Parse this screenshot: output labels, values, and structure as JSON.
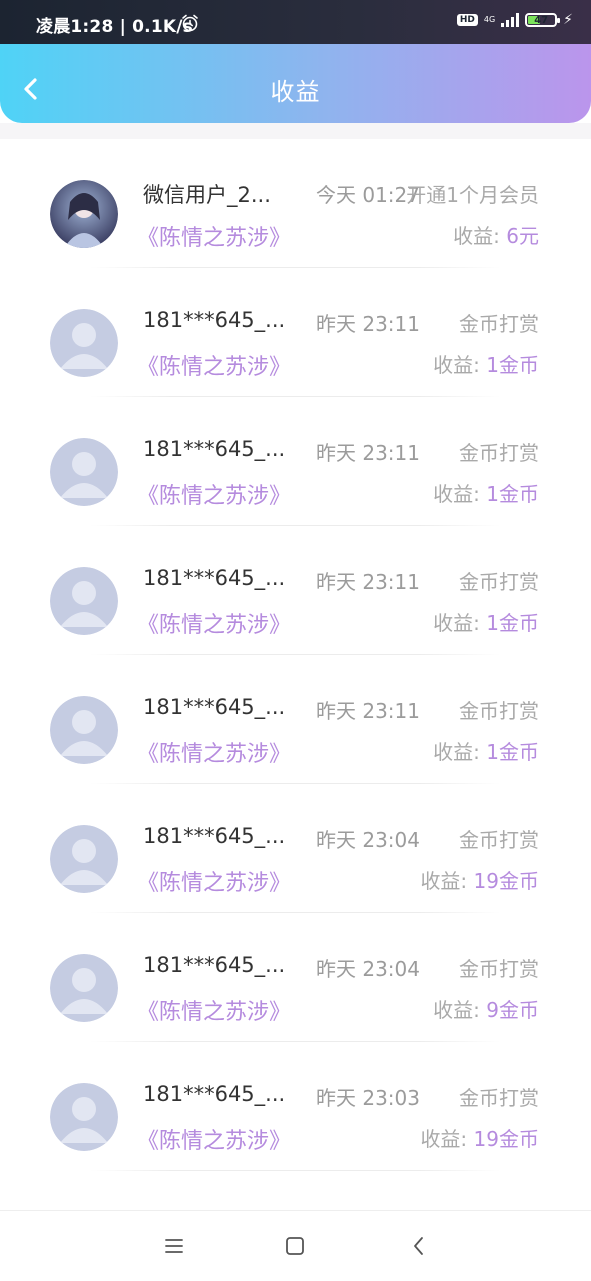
{
  "status_bar": {
    "time_speed": "凌晨1:28 | 0.1K/s",
    "hd": "HD",
    "network": "4G",
    "battery": "47",
    "battery_level": 0.47,
    "alarm_icon": "alarm-clock-icon",
    "signal_icon": "signal-bars-icon",
    "charging_icon": "lightning-bolt-icon"
  },
  "header": {
    "title": "收益",
    "back_icon": "chevron-left-icon"
  },
  "colors": {
    "header_gradient_start": "#4fd3f6",
    "header_gradient_end": "#bb95ec",
    "accent_purple": "#b58bde",
    "text_gray": "#a9a9a9"
  },
  "earnings": [
    {
      "name": "微信用户_2...",
      "time": "今天 01:27",
      "type": "开通1个月会员",
      "book": "《陈情之苏涉》",
      "earn_label": "收益: ",
      "earn_amount": "6元",
      "avatar": "custom"
    },
    {
      "name": "181***645_...",
      "time": "昨天 23:11",
      "type": "金币打赏",
      "book": "《陈情之苏涉》",
      "earn_label": "收益: ",
      "earn_amount": "1金币",
      "avatar": "default"
    },
    {
      "name": "181***645_...",
      "time": "昨天 23:11",
      "type": "金币打赏",
      "book": "《陈情之苏涉》",
      "earn_label": "收益: ",
      "earn_amount": "1金币",
      "avatar": "default"
    },
    {
      "name": "181***645_...",
      "time": "昨天 23:11",
      "type": "金币打赏",
      "book": "《陈情之苏涉》",
      "earn_label": "收益: ",
      "earn_amount": "1金币",
      "avatar": "default"
    },
    {
      "name": "181***645_...",
      "time": "昨天 23:11",
      "type": "金币打赏",
      "book": "《陈情之苏涉》",
      "earn_label": "收益: ",
      "earn_amount": "1金币",
      "avatar": "default"
    },
    {
      "name": "181***645_...",
      "time": "昨天 23:04",
      "type": "金币打赏",
      "book": "《陈情之苏涉》",
      "earn_label": "收益: ",
      "earn_amount": "19金币",
      "avatar": "default"
    },
    {
      "name": "181***645_...",
      "time": "昨天 23:04",
      "type": "金币打赏",
      "book": "《陈情之苏涉》",
      "earn_label": "收益: ",
      "earn_amount": "9金币",
      "avatar": "default"
    },
    {
      "name": "181***645_...",
      "time": "昨天 23:03",
      "type": "金币打赏",
      "book": "《陈情之苏涉》",
      "earn_label": "收益: ",
      "earn_amount": "19金币",
      "avatar": "default"
    }
  ],
  "nav_bar": {
    "menu_icon": "menu-lines-icon",
    "home_icon": "square-home-icon",
    "back_icon": "triangle-back-icon"
  }
}
